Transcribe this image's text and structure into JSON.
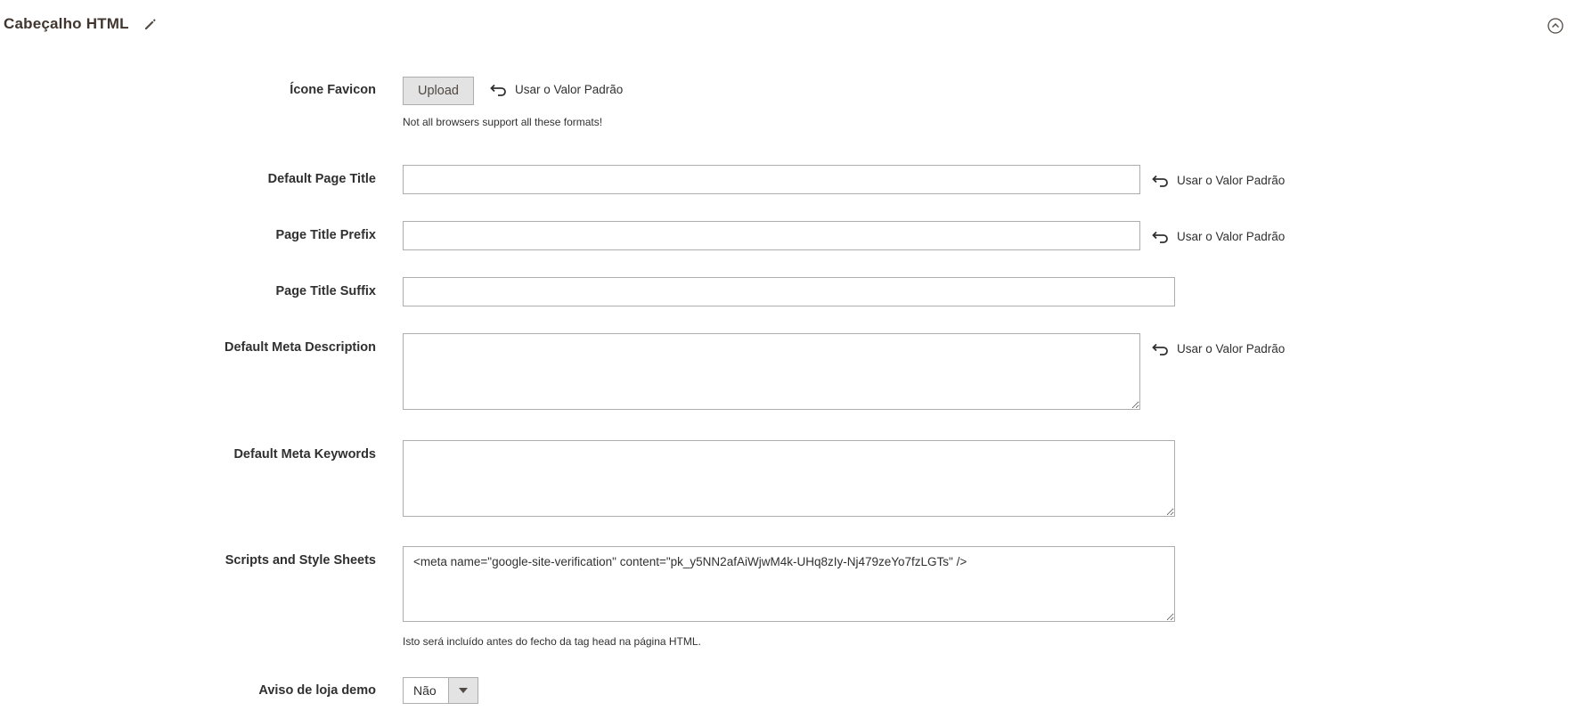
{
  "section": {
    "title": "Cabeçalho HTML"
  },
  "use_default_label": "Usar o Valor Padrão",
  "favicon": {
    "label": "Ícone Favicon",
    "upload_label": "Upload",
    "note": "Not all browsers support all these formats!"
  },
  "default_page_title": {
    "label": "Default Page Title",
    "value": "",
    "placeholder": ""
  },
  "page_title_prefix": {
    "label": "Page Title Prefix",
    "value": "",
    "placeholder": ""
  },
  "page_title_suffix": {
    "label": "Page Title Suffix",
    "value": "",
    "placeholder": ""
  },
  "default_meta_description": {
    "label": "Default Meta Description",
    "value": ""
  },
  "default_meta_keywords": {
    "label": "Default Meta Keywords",
    "value": ""
  },
  "scripts_and_styles": {
    "label": "Scripts and Style Sheets",
    "value": "<meta name=\"google-site-verification\" content=\"pk_y5NN2afAiWjwM4k-UHq8zIy-Nj479zeYo7fzLGTs\" />",
    "note": "Isto será incluído antes do fecho da tag head na página HTML."
  },
  "demo_notice": {
    "label": "Aviso de loja demo",
    "selected": "Não"
  },
  "icons": {
    "edit": "pencil-icon",
    "collapse": "chevron-up-circle-icon",
    "use_default": "undo-arrow-icon",
    "dropdown": "triangle-down-icon"
  },
  "colors": {
    "border": "#adadad",
    "button_bg": "#e3e3e3",
    "text": "#303030",
    "title": "#41362f"
  }
}
